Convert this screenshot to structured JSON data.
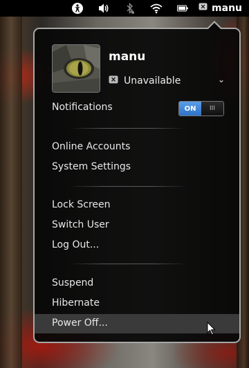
{
  "topbar": {
    "icons": [
      "accessibility-icon",
      "volume-icon",
      "bluetooth-icon",
      "wifi-icon",
      "battery-icon",
      "user-status-icon"
    ],
    "user_name": "manu"
  },
  "menu": {
    "user": {
      "name": "manu",
      "status": "Unavailable",
      "status_icon": "unavailable-status-icon",
      "chevron": "⌄"
    },
    "notifications": {
      "label": "Notifications",
      "toggle_on_label": "ON",
      "toggle_off_glyph": "III",
      "state": "on"
    },
    "section1": [
      "Online Accounts",
      "System Settings"
    ],
    "section2": [
      "Lock Screen",
      "Switch User",
      "Log Out..."
    ],
    "section3": [
      "Suspend",
      "Hibernate",
      "Power Off..."
    ],
    "highlighted_item": "Power Off..."
  },
  "colors": {
    "toggle_accent": "#3a86d8",
    "menu_background": "#080808",
    "menu_border": "#a8a8a8",
    "highlight": "#3a3a3a"
  }
}
